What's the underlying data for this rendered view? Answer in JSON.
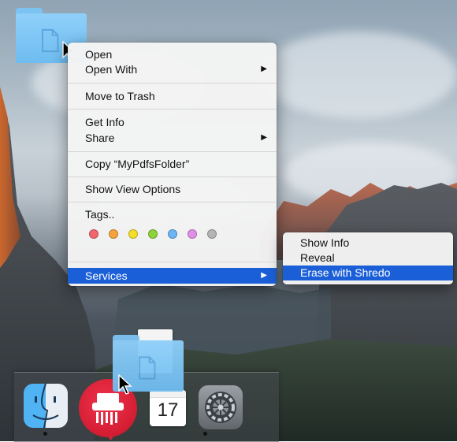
{
  "context_menu": {
    "items": {
      "open": "Open",
      "open_with": "Open With",
      "move_to_trash": "Move to Trash",
      "get_info": "Get Info",
      "share": "Share",
      "copy": "Copy “MyPdfsFolder”",
      "show_view_options": "Show View Options",
      "tags": "Tags..",
      "services": "Services"
    },
    "tag_colors": [
      "#f2676d",
      "#f7a33c",
      "#f4de2a",
      "#8ed33a",
      "#6bb5f3",
      "#e08fe8",
      "#b5b5b5"
    ]
  },
  "services_submenu": {
    "items": [
      "Show Info",
      "Reveal",
      "Erase with Shredo"
    ],
    "highlighted": "Erase with Shredo"
  },
  "dock": {
    "calendar_day": "17",
    "apps": [
      "finder-icon",
      "shredo-app-icon",
      "calendar-icon",
      "system-preferences-icon"
    ]
  },
  "colors": {
    "highlight": "#1b5fd8",
    "folder": "#7cc4f4"
  }
}
